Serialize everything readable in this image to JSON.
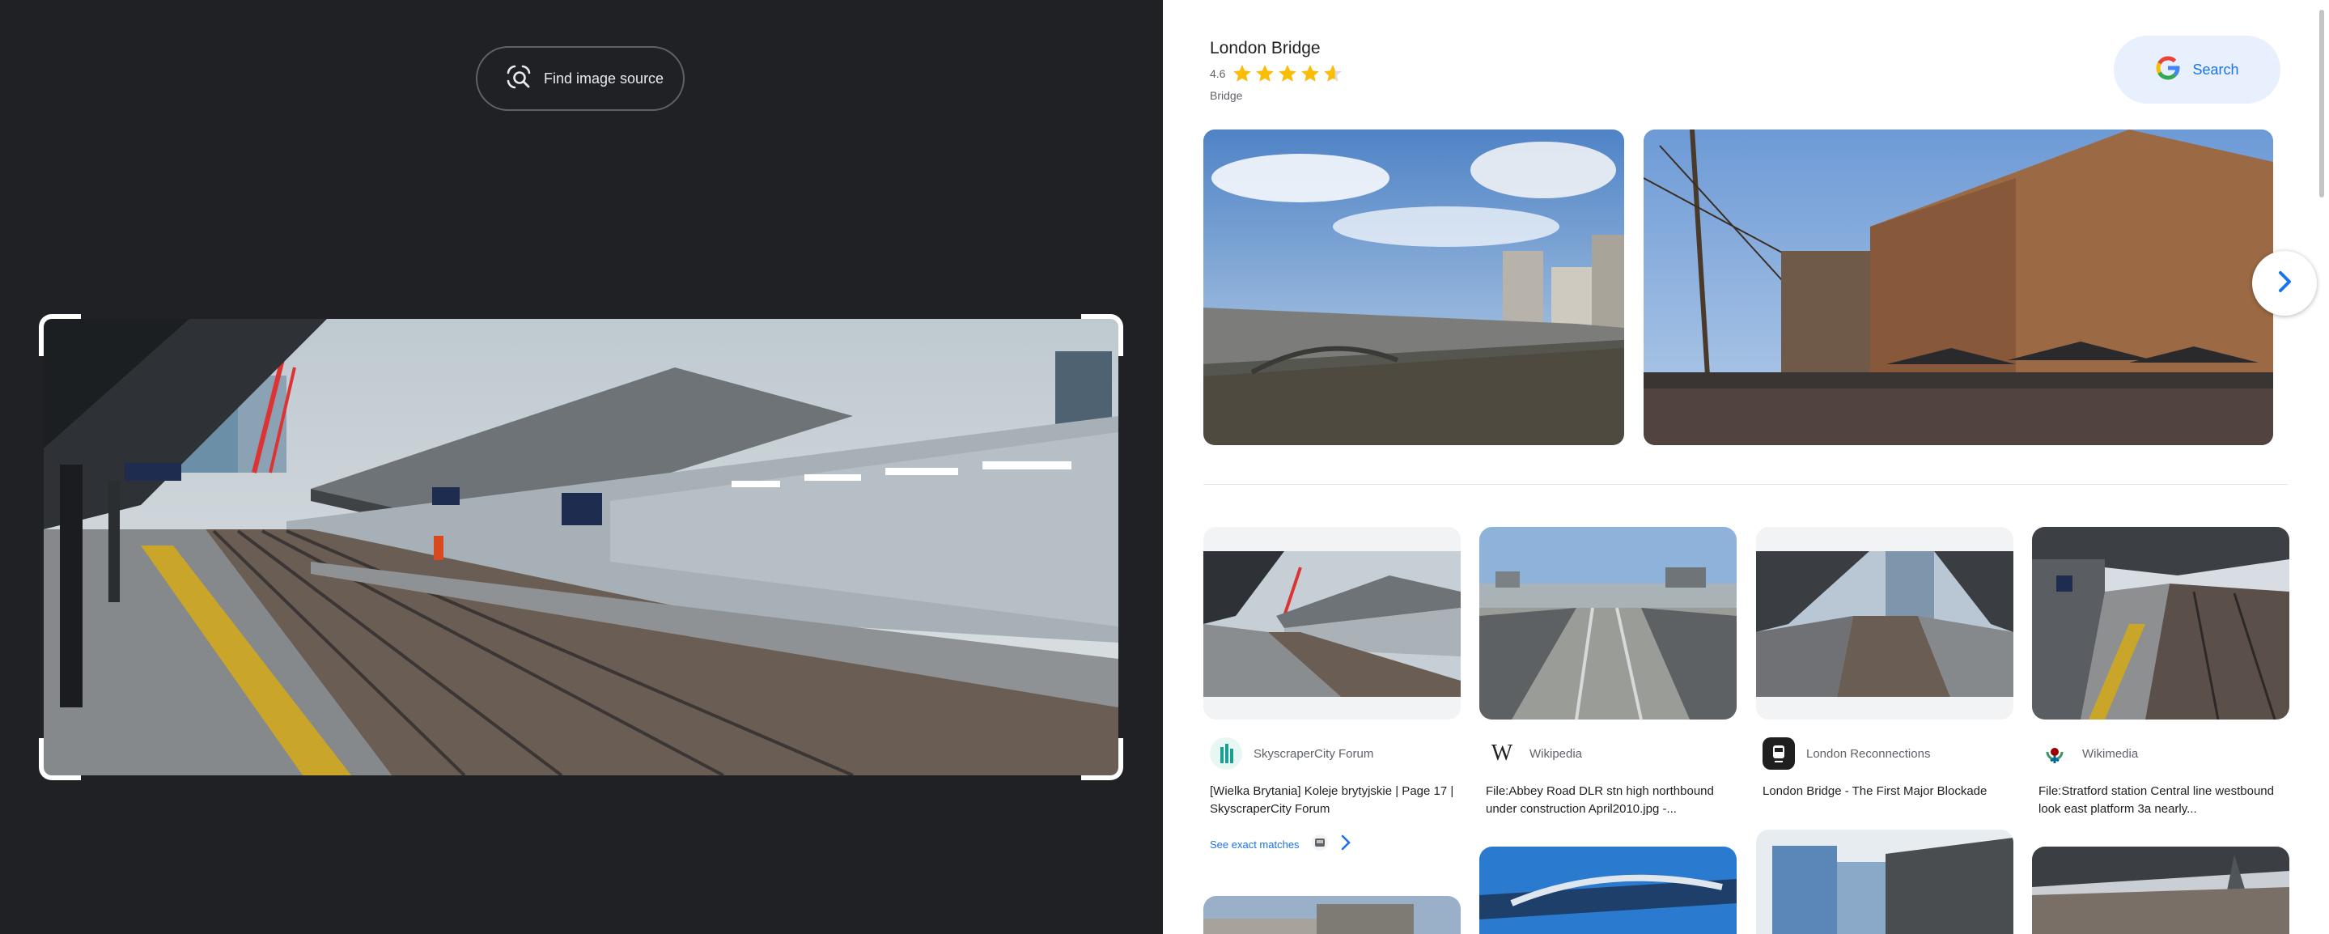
{
  "left": {
    "find_source_label": "Find image source"
  },
  "entity": {
    "title": "London Bridge",
    "rating": "4.6",
    "stars": 4.6,
    "type": "Bridge"
  },
  "search_button_label": "Search",
  "results": [
    {
      "source": "SkyscraperCity Forum",
      "title": "[Wielka Brytania] Koleje brytyjskie | Page 17 | SkyscraperCity Forum"
    },
    {
      "source": "Wikipedia",
      "title": "File:Abbey Road DLR stn high northbound under construction April2010.jpg -..."
    },
    {
      "source": "London Reconnections",
      "title": "London Bridge - The First Major Blockade"
    },
    {
      "source": "Wikimedia",
      "title": "File:Stratford station Central line westbound look east platform 3a nearly..."
    }
  ],
  "exact_matches_label": "See exact matches",
  "colors": {
    "accent": "#1a73e8",
    "dark_bg": "#202124",
    "star": "#fbbc04"
  },
  "icons": [
    "lens-search-icon",
    "star-icon",
    "google-g-icon",
    "chevron-right-icon",
    "wikipedia-icon"
  ]
}
